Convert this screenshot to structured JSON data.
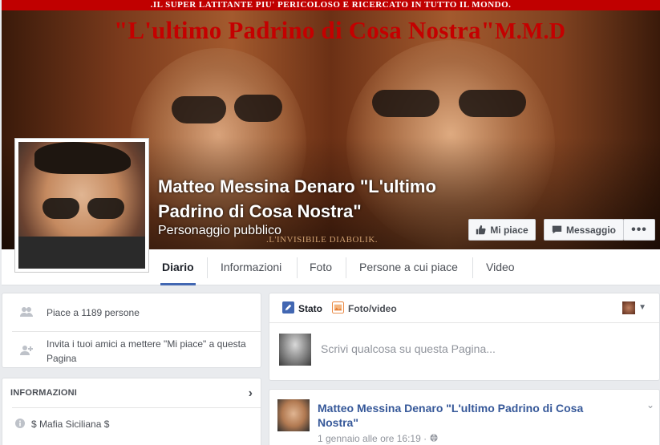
{
  "cover": {
    "banner_text": ".IL SUPER LATITANTE PIU' PERICOLOSO E RICERCATO IN TUTTO IL MONDO.",
    "title_text": "\"L'ultimo Padrino di Cosa Nostra\"",
    "title_suffix": "M.M.D",
    "tagline": ".L'INVISIBILE DIABOLIK."
  },
  "page": {
    "name": "Matteo Messina Denaro \"L'ultimo Padrino di Cosa Nostra\"",
    "category": "Personaggio pubblico"
  },
  "actions": {
    "like_label": "Mi piace",
    "message_label": "Messaggio",
    "more_label": "•••"
  },
  "tabs": [
    {
      "label": "Diario",
      "active": true
    },
    {
      "label": "Informazioni",
      "active": false
    },
    {
      "label": "Foto",
      "active": false
    },
    {
      "label": "Persone a cui piace",
      "active": false
    },
    {
      "label": "Video",
      "active": false
    }
  ],
  "sidebar": {
    "likes_text": "Piace a 1189 persone",
    "invite_text": "Invita i tuoi amici a mettere \"Mi piace\" a questa Pagina",
    "info_header": "INFORMAZIONI",
    "info_chevron": "›",
    "info_item": "$ Mafia Siciliana $"
  },
  "composer": {
    "status_label": "Stato",
    "photo_label": "Foto/video",
    "placeholder": "Scrivi qualcosa su questa Pagina..."
  },
  "post": {
    "author": "Matteo Messina Denaro \"L'ultimo Padrino di Cosa Nostra\"",
    "timestamp": "1 gennaio alle ore 16:19 ·"
  },
  "colors": {
    "accent": "#4267b2",
    "link": "#365899",
    "banner_red": "#c00000"
  }
}
